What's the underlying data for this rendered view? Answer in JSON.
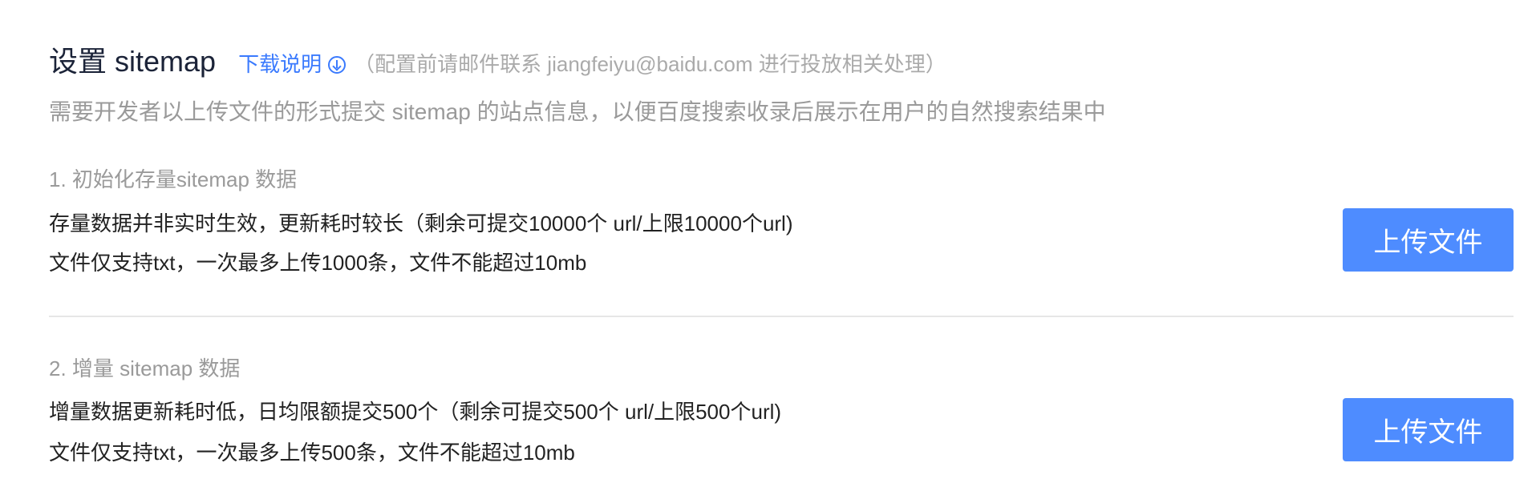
{
  "header": {
    "title": "设置 sitemap",
    "download_link": "下载说明",
    "download_icon": "download-circle-icon",
    "note": "（配置前请邮件联系 jiangfeiyu@baidu.com 进行投放相关处理）",
    "subtitle": "需要开发者以上传文件的形式提交 sitemap 的站点信息，以便百度搜索收录后展示在用户的自然搜索结果中"
  },
  "sections": [
    {
      "label": "1. 初始化存量sitemap 数据",
      "line1": "存量数据并非实时生效，更新耗时较长（剩余可提交10000个 url/上限10000个url)",
      "line2": "文件仅支持txt，一次最多上传1000条，文件不能超过10mb",
      "button": "上传文件"
    },
    {
      "label": "2. 增量 sitemap 数据",
      "line1": "增量数据更新耗时低，日均限额提交500个（剩余可提交500个 url/上限500个url)",
      "line2": "文件仅支持txt，一次最多上传500条，文件不能超过10mb",
      "button": "上传文件"
    }
  ],
  "colors": {
    "accent": "#4e8cff",
    "link": "#3a7afe",
    "title": "#1b2338",
    "muted": "#9a9a9a"
  }
}
